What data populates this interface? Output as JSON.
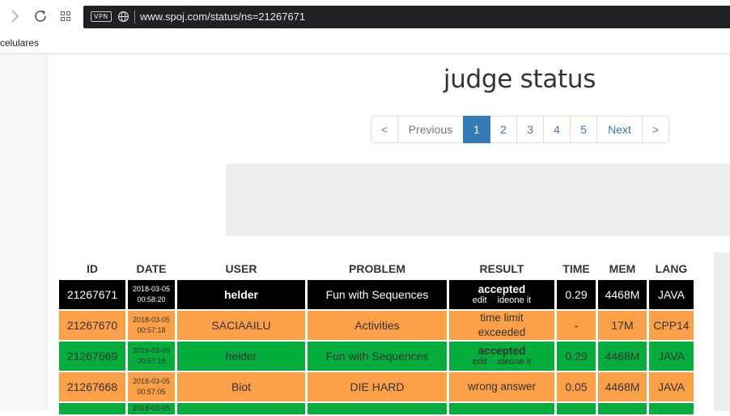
{
  "browser": {
    "url": "www.spoj.com/status/ns=21267671",
    "vpn_label": "VPN",
    "bookmark": "celulares",
    "icons": [
      "chevron-right-icon",
      "reload-icon",
      "apps-grid-icon",
      "globe-icon"
    ]
  },
  "page": {
    "title": "judge status"
  },
  "pagination": {
    "first": "<",
    "previous": "Previous",
    "pages": [
      "1",
      "2",
      "3",
      "4",
      "5"
    ],
    "active": "1",
    "next": "Next",
    "last": ">"
  },
  "table": {
    "headers": [
      "ID",
      "DATE",
      "USER",
      "PROBLEM",
      "RESULT",
      "TIME",
      "MEM",
      "LANG"
    ],
    "rows": [
      {
        "id": "21267671",
        "date": "2018-03-05",
        "time_of_day": "00:58:20",
        "user": "helder",
        "problem": "Fun with Sequences",
        "result": "accepted",
        "edit": "edit",
        "ideone": "ideone it",
        "time": "0.29",
        "mem": "4468M",
        "lang": "JAVA",
        "color": "#000000"
      },
      {
        "id": "21267670",
        "date": "2018-03-05",
        "time_of_day": "00:57:18",
        "user": "SACIAAILU",
        "problem": "Activities",
        "result": "time limit exceeded",
        "result_line1": "time limit",
        "result_line2": "exceeded",
        "time": "-",
        "mem": "17M",
        "lang": "CPP14",
        "color": "#fca048"
      },
      {
        "id": "21267669",
        "date": "2018-03-05",
        "time_of_day": "00:57:18",
        "user": "helder",
        "problem": "Fun with Sequences",
        "result": "accepted",
        "edit": "edit",
        "ideone": "ideone it",
        "time": "0.29",
        "mem": "4468M",
        "lang": "JAVA",
        "color": "#04ad3c"
      },
      {
        "id": "21267668",
        "date": "2018-03-05",
        "time_of_day": "00:57:05",
        "user": "Biot",
        "problem": "DIE HARD",
        "result": "wrong answer",
        "time": "0.05",
        "mem": "4468M",
        "lang": "JAVA",
        "color": "#fca048"
      }
    ],
    "partial_row_date": "2018-03-05"
  }
}
